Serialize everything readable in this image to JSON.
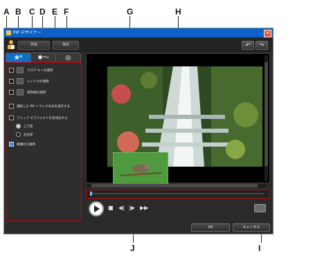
{
  "callouts": {
    "A": "A",
    "B": "B",
    "C": "C",
    "D": "D",
    "E": "E",
    "F": "F",
    "G": "G",
    "H": "H",
    "I": "I",
    "J": "J"
  },
  "window": {
    "title": "PiP デザイナー",
    "toolbar": {
      "btn1": "共有",
      "btn2": "保存",
      "undo": "↶",
      "redo": "↷"
    },
    "tabs": [
      {
        "label": "❀*",
        "active": true
      },
      {
        "label": "✱〜",
        "active": false
      },
      {
        "label": "◎",
        "active": false
      }
    ],
    "options": {
      "chroma_key": "クロマ キーの適用",
      "shadow": "シャドウの適用",
      "border": "境界線の適用",
      "show_selected_tracks": "選択した PiP トラックのみを表示する",
      "flip_object": "フリップ オブジェクトを有効化する",
      "up_down": "上下逆",
      "left_right": "左右逆",
      "keep_aspect": "縦横比を維持"
    },
    "footer": {
      "ok": "OK",
      "cancel": "キャンセル"
    },
    "colors": {
      "titlebar": "#0b61c7",
      "accent": "#0f6fc4",
      "highlight": "#cc0000"
    }
  }
}
